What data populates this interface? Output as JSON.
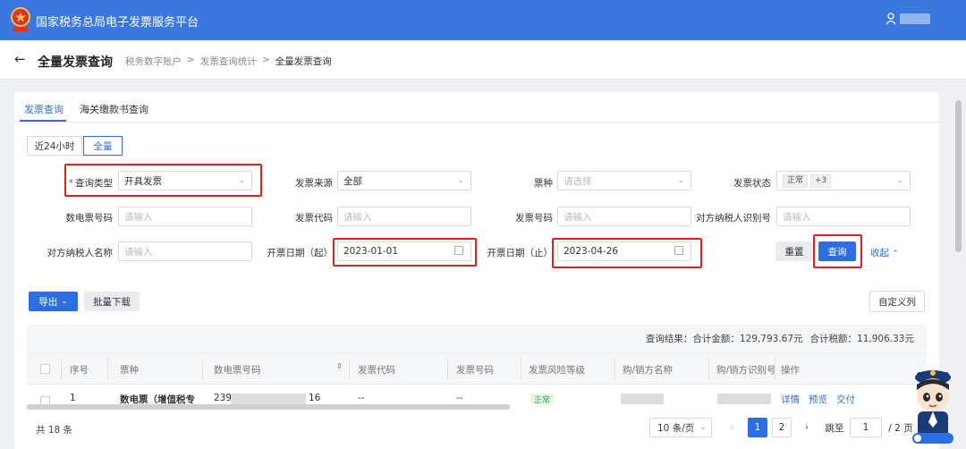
{
  "header": {
    "platform_title": "国家税务总局电子发票服务平台"
  },
  "titlebar": {
    "page_title": "全量发票查询",
    "breadcrumb": [
      "税务数字账户",
      ">",
      "发票查询统计",
      ">",
      "全量发票查询"
    ]
  },
  "tabs": [
    "发票查询",
    "海关缴款书查询"
  ],
  "range": [
    "近24小时",
    "全量"
  ],
  "form": {
    "query_type": {
      "required": "*",
      "label": "查询类型",
      "value": "开具发票"
    },
    "source": {
      "label": "发票来源",
      "value": "全部"
    },
    "ticket_kind": {
      "label": "票种",
      "placeholder": "请选择"
    },
    "status": {
      "label": "发票状态",
      "tags": [
        "正常",
        "+3"
      ]
    },
    "digital_no": {
      "label": "数电票号码",
      "placeholder": "请输入"
    },
    "invoice_code": {
      "label": "发票代码",
      "placeholder": "请输入"
    },
    "invoice_no": {
      "label": "发票号码",
      "placeholder": "请输入"
    },
    "counterparty_id": {
      "label": "对方纳税人识别号",
      "placeholder": "请输入"
    },
    "counterparty_name": {
      "label": "对方纳税人名称",
      "placeholder": "请输入"
    },
    "date_start": {
      "label": "开票日期（起）",
      "value": "2023-01-01"
    },
    "date_end": {
      "label": "开票日期（止）",
      "value": "2023-04-26"
    },
    "reset": "重置",
    "search": "查询",
    "collapse": "收起"
  },
  "toolbar": {
    "export": "导出",
    "bulk_download": "批量下载",
    "custom_columns": "自定义列"
  },
  "summary": {
    "result_label": "查询结果：",
    "total_amount": "合计金额：129,793.67元",
    "total_tax": "合计税额：11,906.33元"
  },
  "table": {
    "headers": [
      "序号",
      "票种",
      "数电票号码",
      "发票代码",
      "发票号码",
      "发票风险等级",
      "购/销方名称",
      "购/销方识别号",
      "操作"
    ],
    "row": {
      "index": "1",
      "kind": "数电票（增值税专",
      "no_prefix": "239",
      "no_suffix": "16",
      "code": "--",
      "num": "--",
      "risk": "正常",
      "actions": [
        "详情",
        "预览",
        "交付"
      ]
    }
  },
  "pagination": {
    "total": "共 18 条",
    "page_size": "10 条/页",
    "pages": [
      "1",
      "2"
    ],
    "jump_label": "跳至",
    "jump_value": "1",
    "total_pages": "/ 2 页"
  },
  "colors": {
    "primary": "#2d6fe0",
    "header": "#3a78e0",
    "highlight": "#e02020"
  }
}
